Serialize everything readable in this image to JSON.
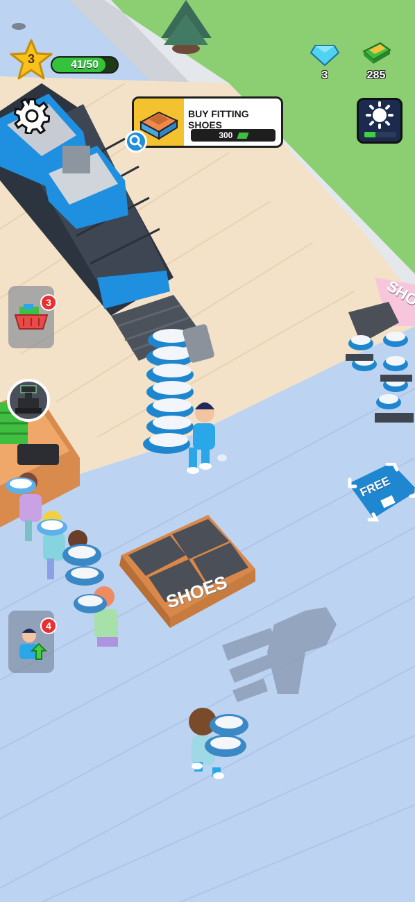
{
  "hud": {
    "level": "3",
    "xp_text": "41/50",
    "xp_progress": 0.82,
    "gems": "3",
    "cash": "285"
  },
  "task": {
    "title": "BUY FITTING SHOES",
    "cost": "300"
  },
  "day_night_progress": 0.35,
  "side_buttons": {
    "basket_badge": "3",
    "hire_badge": "4"
  },
  "world_labels": {
    "free": "FREE",
    "shoes_stand": "SHOES",
    "shoes_wall": "SHO"
  },
  "colors": {
    "accent_green": "#34c33a",
    "task_yellow": "#f4c22e",
    "badge_red": "#e73131",
    "floor_blue": "#bcd3f1"
  },
  "icons": {
    "settings": "gear-icon",
    "gem": "diamond-icon",
    "cash": "cash-icon",
    "day_night": "sun-icon",
    "basket": "basket-icon",
    "register": "cash-register-icon",
    "hire": "worker-upgrade-icon",
    "search": "magnifier-icon"
  }
}
